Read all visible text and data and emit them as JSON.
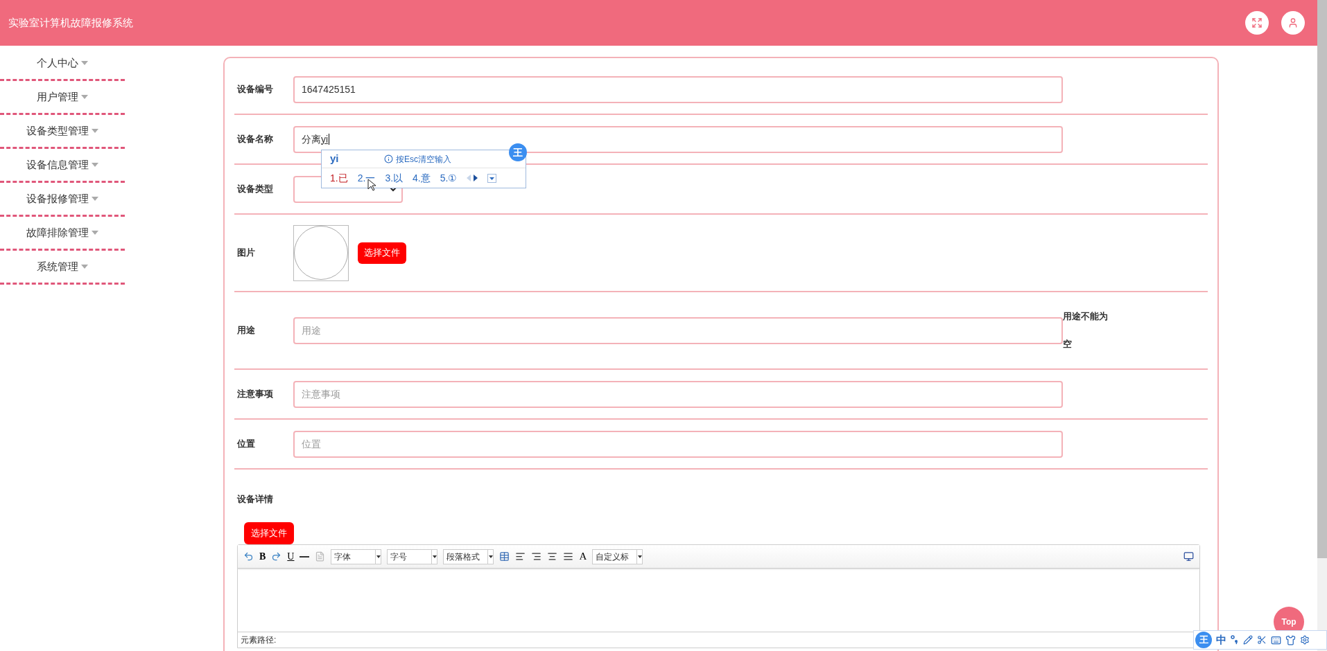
{
  "header": {
    "title": "实验室计算机故障报修系统"
  },
  "sidebar": {
    "items": [
      {
        "label": "个人中心"
      },
      {
        "label": "用户管理"
      },
      {
        "label": "设备类型管理"
      },
      {
        "label": "设备信息管理"
      },
      {
        "label": "设备报修管理"
      },
      {
        "label": "故障排除管理"
      },
      {
        "label": "系统管理"
      }
    ]
  },
  "form": {
    "fields": [
      {
        "kind": "text",
        "label": "设备编号",
        "value": "1647425151"
      },
      {
        "kind": "text",
        "label": "设备名称",
        "value": "分离",
        "composition": "yi"
      },
      {
        "kind": "select",
        "label": "设备类型"
      },
      {
        "kind": "image",
        "label": "图片",
        "button": "选择文件"
      },
      {
        "kind": "text",
        "label": "用途",
        "placeholder": "用途",
        "error": "用途不能为空"
      },
      {
        "kind": "text",
        "label": "注意事项",
        "placeholder": "注意事项"
      },
      {
        "kind": "text",
        "label": "位置",
        "placeholder": "位置"
      }
    ]
  },
  "details": {
    "label": "设备详情",
    "button": "选择文件",
    "toolbar": {
      "bold": "B",
      "underline": "U",
      "font_color": "A",
      "dropdowns": [
        "字体",
        "字号",
        "段落格式",
        "自定义标"
      ]
    },
    "status": "元素路径:"
  },
  "ime_popup": {
    "composition": "yi",
    "hint": "按Esc清空输入",
    "logo": "王",
    "candidates": [
      {
        "label": "1.已",
        "selected": true
      },
      {
        "label": "2.一",
        "selected": false
      },
      {
        "label": "3.以",
        "selected": false
      },
      {
        "label": "4.意",
        "selected": false
      },
      {
        "label": "5.①",
        "selected": false
      }
    ]
  },
  "top_button": "Top",
  "ime_bar": {
    "logo": "王",
    "mode": "中"
  }
}
